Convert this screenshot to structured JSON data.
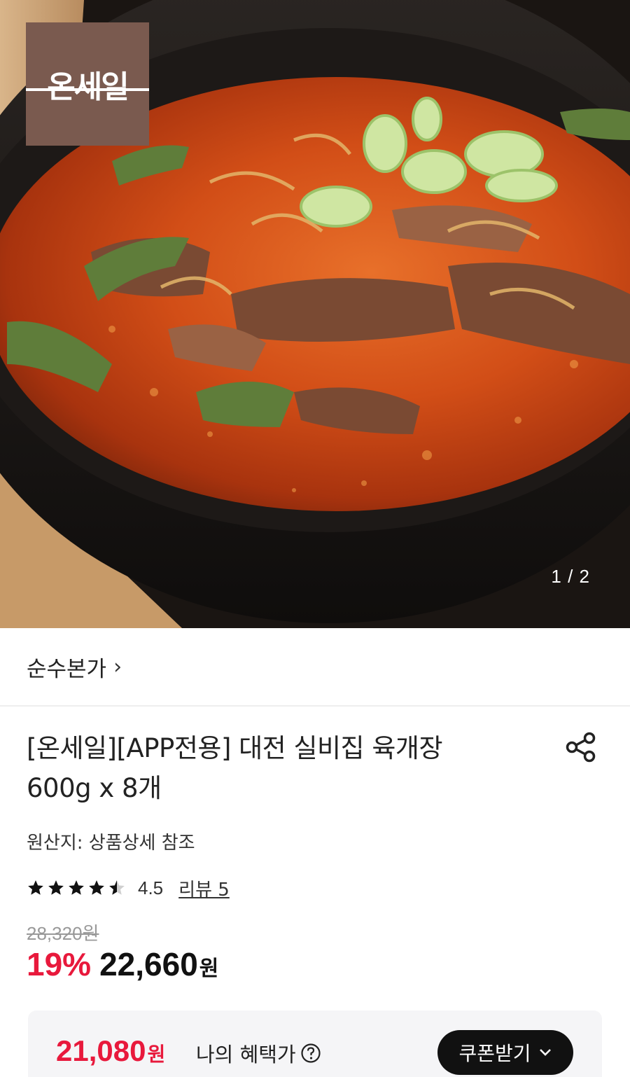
{
  "hero": {
    "badge_text": "온세일",
    "pager": "1 / 2"
  },
  "brand": {
    "name": "순수본가",
    "chevron": "›"
  },
  "product": {
    "title_line1": "[온세일][APP전용] 대전 실비집 육개장",
    "title_line2": "600g x 8개",
    "origin": "원산지: 상품상세 참조"
  },
  "rating": {
    "stars": 4.5,
    "max_stars": 5,
    "value": "4.5",
    "review_link": "리뷰 5"
  },
  "price": {
    "original": "28,320원",
    "discount": "19%",
    "sale": "22,660",
    "won": "원"
  },
  "benefit": {
    "price": "21,080",
    "won": "원",
    "label": "나의 혜택가",
    "coupon_button": "쿠폰받기"
  },
  "icons": {
    "share": "share-icon",
    "help": "question-circle-icon",
    "coupon_chevron": "chevron-down-icon"
  },
  "colors": {
    "accent_red": "#e8193c",
    "badge_brown": "#7a5a4f",
    "button_dark": "#111111"
  }
}
